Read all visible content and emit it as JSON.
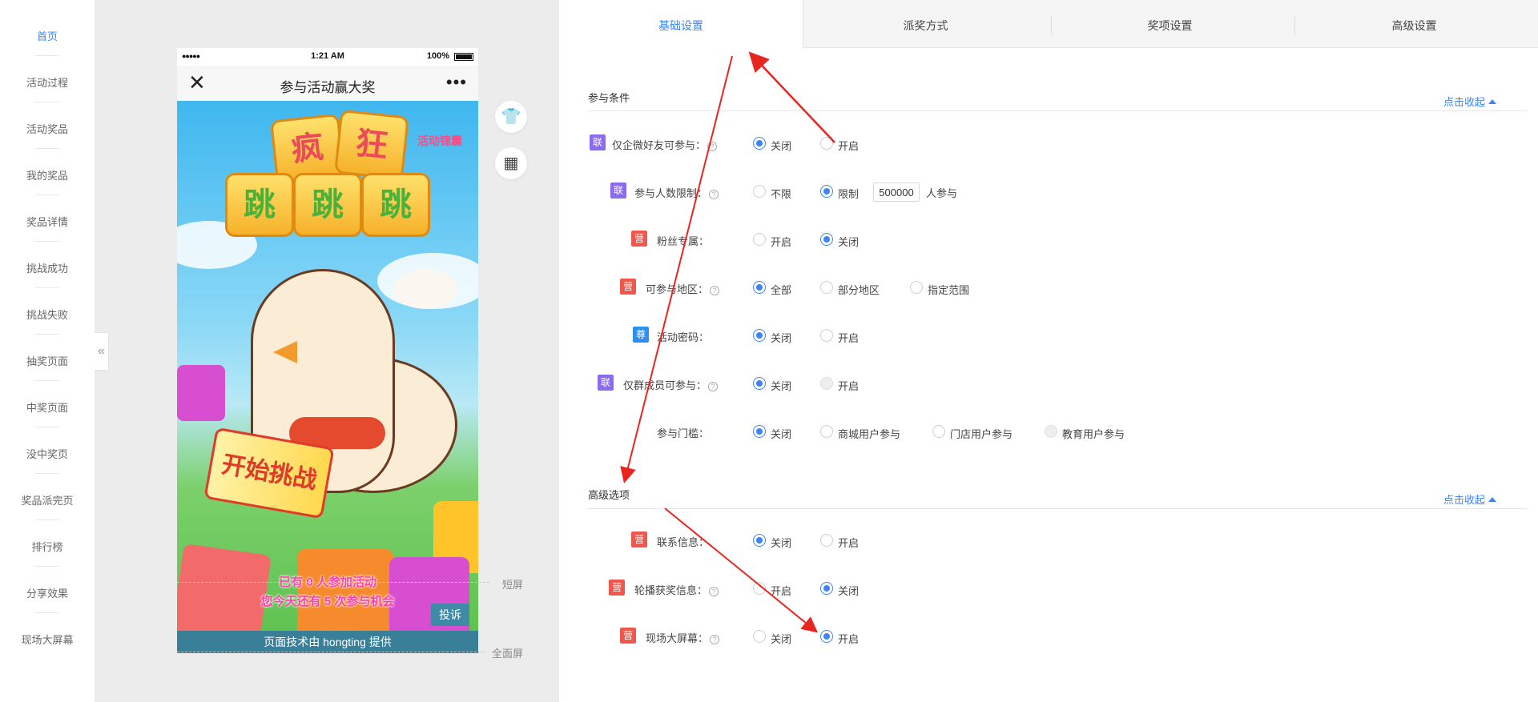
{
  "nav": {
    "items": [
      "首页",
      "活动过程",
      "活动奖品",
      "我的奖品",
      "奖品详情",
      "挑战成功",
      "挑战失败",
      "抽奖页面",
      "中奖页面",
      "没中奖页",
      "奖品派完页",
      "排行榜",
      "分享效果",
      "现场大屏幕"
    ],
    "active_index": 0,
    "collapse_glyph": "«"
  },
  "phone": {
    "status_time": "1:21 AM",
    "status_battery": "100%",
    "title": "参与活动赢大奖",
    "close_glyph": "✕",
    "more_glyph": "•••",
    "game_title_tiles": [
      "疯",
      "狂",
      "跳",
      "跳",
      "跳"
    ],
    "corner_badge": "活动锦囊",
    "flag_text": "开始挑战",
    "line1": "已有 0 人参加活动",
    "line2": "您今天还有 5 次参与机会",
    "complain_button": "投诉",
    "footer": "页面技术由 hongting 提供"
  },
  "markers": {
    "short": "短屏",
    "full": "全面屏"
  },
  "tabs": [
    "基础设置",
    "派奖方式",
    "奖项设置",
    "高级设置"
  ],
  "active_tab": 0,
  "sections": {
    "participation": {
      "title": "参与条件",
      "toggle": "点击收起"
    },
    "advanced": {
      "title": "高级选项",
      "toggle": "点击收起"
    }
  },
  "rows": {
    "wechat_friends": {
      "tag": "联",
      "label": "仅企微好友可参与：",
      "options": [
        "关闭",
        "开启"
      ],
      "selected": 0
    },
    "limit": {
      "tag": "联",
      "label": "参与人数限制：",
      "options": [
        "不限",
        "限制"
      ],
      "selected": 1,
      "value": "500000",
      "suffix": "人参与"
    },
    "fans": {
      "tag": "营",
      "label": "粉丝专属：",
      "options": [
        "开启",
        "关闭"
      ],
      "selected": 1
    },
    "region": {
      "tag": "营",
      "label": "可参与地区：",
      "options": [
        "全部",
        "部分地区",
        "指定范围"
      ],
      "selected": 0
    },
    "password": {
      "tag": "尊",
      "label": "活动密码：",
      "options": [
        "关闭",
        "开启"
      ],
      "selected": 0
    },
    "group": {
      "tag": "联",
      "label": "仅群成员可参与：",
      "options": [
        "关闭",
        "开启"
      ],
      "selected": 0
    },
    "threshold": {
      "label": "参与门槛：",
      "options": [
        "关闭",
        "商城用户参与",
        "门店用户参与",
        "教育用户参与"
      ],
      "selected": 0
    },
    "contact": {
      "tag": "营",
      "label": "联系信息：",
      "options": [
        "关闭",
        "开启"
      ],
      "selected": 0
    },
    "carousel": {
      "tag": "营",
      "label": "轮播获奖信息：",
      "options": [
        "开启",
        "关闭"
      ],
      "selected": 1
    },
    "bigscreen": {
      "tag": "营",
      "label": "现场大屏幕：",
      "options": [
        "关闭",
        "开启"
      ],
      "selected": 1
    }
  },
  "icons": {
    "help": "?",
    "shirt": "👕",
    "grid": "▦"
  },
  "colors": {
    "accent": "#3e84f6",
    "arrow": "#e8251f",
    "tag_lian": "#8b6cf0",
    "tag_ying": "#f0584e",
    "tag_zun": "#2f8ff0"
  }
}
